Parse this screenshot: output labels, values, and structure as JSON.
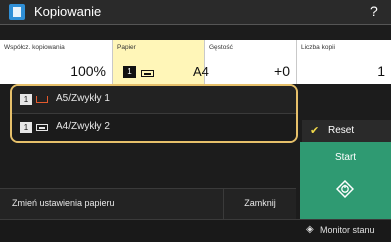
{
  "titlebar": {
    "title": "Kopiowanie",
    "help": "?"
  },
  "info": {
    "ratio": {
      "label": "Współcz. kopiowania",
      "value": "100%"
    },
    "paper": {
      "label": "Papier",
      "badge": "1",
      "value": "A4"
    },
    "density": {
      "label": "Gęstość",
      "value": "+0"
    },
    "copies": {
      "label": "Liczba kopii",
      "value": "1"
    }
  },
  "paper_list": [
    {
      "badge": "1",
      "label": "A5/Zwykły 1"
    },
    {
      "badge": "1",
      "label": "A4/Zwykły 2"
    }
  ],
  "buttons": {
    "reset": "Reset",
    "start": "Start",
    "change_paper": "Zmień ustawienia papieru",
    "close": "Zamknij",
    "status_monitor": "Monitor stanu"
  },
  "colors": {
    "accent": "#e6c06a",
    "start": "#2f9a72",
    "app_icon": "#2f8fd6",
    "paper_highlight": "#fff6b8"
  }
}
